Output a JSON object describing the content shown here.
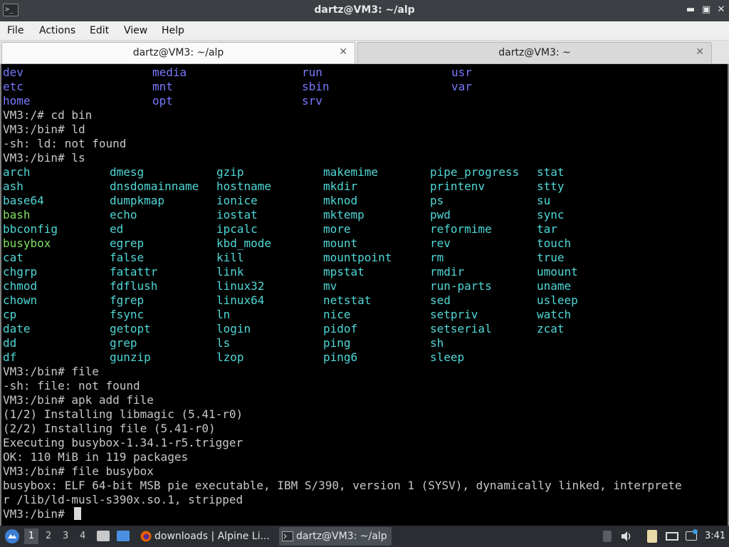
{
  "window": {
    "title": "dartz@VM3: ~/alp",
    "app_icon_text": ">_"
  },
  "menu": [
    "File",
    "Actions",
    "Edit",
    "View",
    "Help"
  ],
  "tabs": [
    {
      "label": "dartz@VM3: ~/alp",
      "active": true
    },
    {
      "label": "dartz@VM3: ~",
      "active": false
    }
  ],
  "terminal": {
    "root_dirs": [
      [
        "dev",
        "media",
        "run",
        "usr"
      ],
      [
        "etc",
        "mnt",
        "sbin",
        "var"
      ],
      [
        "home",
        "opt",
        "srv",
        ""
      ]
    ],
    "lines_a": [
      "VM3:/# cd bin",
      "VM3:/bin# ld",
      "-sh: ld: not found",
      "VM3:/bin# ls"
    ],
    "bin_files": [
      [
        "arch",
        "dmesg",
        "gzip",
        "makemime",
        "pipe_progress",
        "stat"
      ],
      [
        "ash",
        "dnsdomainname",
        "hostname",
        "mkdir",
        "printenv",
        "stty"
      ],
      [
        "base64",
        "dumpkmap",
        "ionice",
        "mknod",
        "ps",
        "su"
      ],
      [
        "bash",
        "echo",
        "iostat",
        "mktemp",
        "pwd",
        "sync"
      ],
      [
        "bbconfig",
        "ed",
        "ipcalc",
        "more",
        "reformime",
        "tar"
      ],
      [
        "busybox",
        "egrep",
        "kbd_mode",
        "mount",
        "rev",
        "touch"
      ],
      [
        "cat",
        "false",
        "kill",
        "mountpoint",
        "rm",
        "true"
      ],
      [
        "chgrp",
        "fatattr",
        "link",
        "mpstat",
        "rmdir",
        "umount"
      ],
      [
        "chmod",
        "fdflush",
        "linux32",
        "mv",
        "run-parts",
        "uname"
      ],
      [
        "chown",
        "fgrep",
        "linux64",
        "netstat",
        "sed",
        "usleep"
      ],
      [
        "cp",
        "fsync",
        "ln",
        "nice",
        "setpriv",
        "watch"
      ],
      [
        "date",
        "getopt",
        "login",
        "pidof",
        "setserial",
        "zcat"
      ],
      [
        "dd",
        "grep",
        "ls",
        "ping",
        "sh",
        ""
      ],
      [
        "df",
        "gunzip",
        "lzop",
        "ping6",
        "sleep",
        ""
      ]
    ],
    "green_files": [
      "bash",
      "busybox"
    ],
    "lines_b": [
      "VM3:/bin# file",
      "-sh: file: not found",
      "VM3:/bin# apk add file",
      "(1/2) Installing libmagic (5.41-r0)",
      "(2/2) Installing file (5.41-r0)",
      "Executing busybox-1.34.1-r5.trigger",
      "OK: 110 MiB in 119 packages",
      "VM3:/bin# file busybox",
      "busybox: ELF 64-bit MSB pie executable, IBM S/390, version 1 (SYSV), dynamically linked, interprete",
      "r /lib/ld-musl-s390x.so.1, stripped",
      "VM3:/bin# "
    ]
  },
  "taskbar": {
    "workspaces": [
      "1",
      "2",
      "3",
      "4"
    ],
    "tasks": [
      {
        "label": "downloads | Alpine Li...",
        "icon": "firefox-icon"
      },
      {
        "label": "dartz@VM3: ~/alp",
        "icon": "terminal-icon"
      }
    ],
    "clock": "3:41",
    "colors": {
      "dir": "#7878ff",
      "exec": "#50d8d8",
      "exec_green": "#80e060",
      "text": "#c8c8c8",
      "bg": "#000000"
    }
  }
}
